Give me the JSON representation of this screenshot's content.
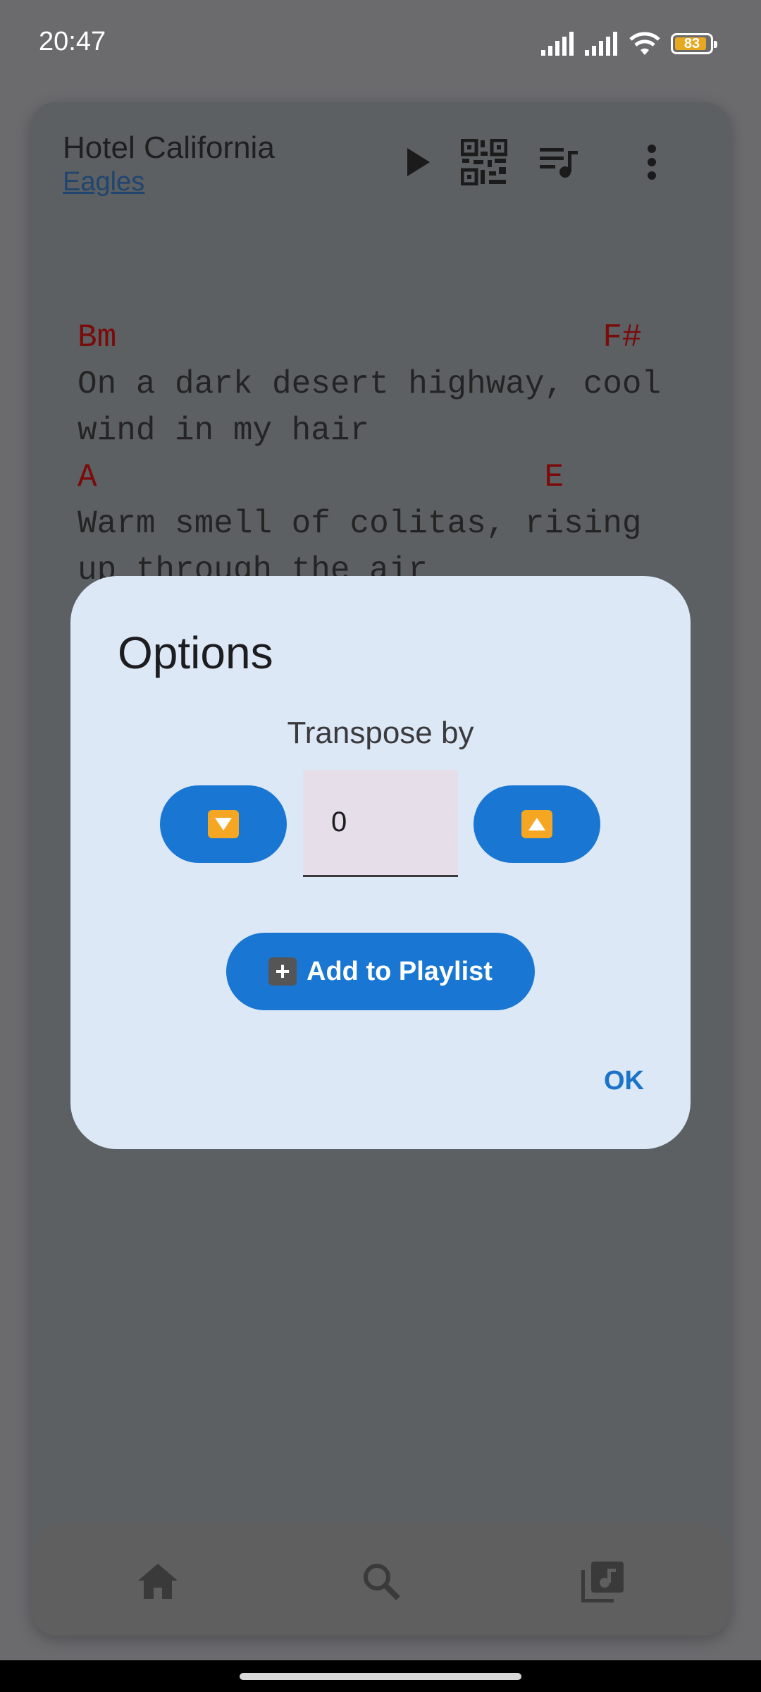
{
  "status": {
    "time": "20:47",
    "battery_level": "83"
  },
  "header": {
    "title": "Hotel California",
    "artist": "Eagles",
    "icons": [
      "play-icon",
      "qr-code-icon",
      "playlist-icon",
      "more-vert-icon"
    ]
  },
  "lyrics": {
    "lines": [
      "Bm                         F#",
      "On a dark desert highway, cool",
      "wind in my hair",
      "",
      "A                       E",
      "Warm smell of colitas, rising",
      "up through the air"
    ]
  },
  "dialog": {
    "title": "Options",
    "transpose_label": "Transpose by",
    "transpose_value": "0",
    "add_to_playlist": "Add to Playlist",
    "ok": "OK"
  },
  "bottom_nav": {
    "items": [
      "home-icon",
      "search-icon",
      "music-library-icon"
    ]
  },
  "colors": {
    "accent": "#1976d2",
    "chord": "#7a0b0b",
    "dialog_bg": "#dce8f6"
  }
}
